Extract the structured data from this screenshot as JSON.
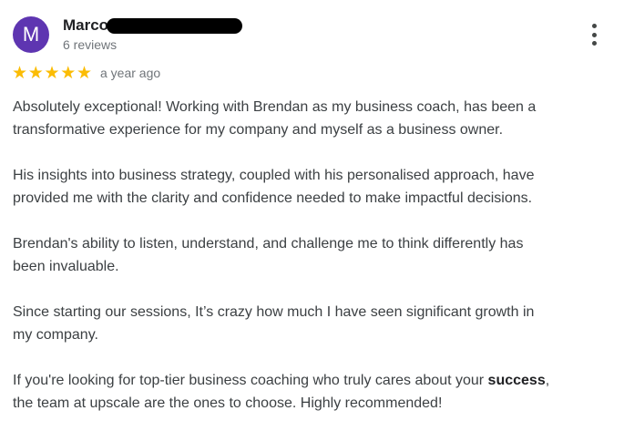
{
  "reviewer": {
    "avatar_initial": "M",
    "avatar_color": "#5e35b1",
    "name": "Marco",
    "name_redacted": true,
    "review_count": "6 reviews"
  },
  "menu": {
    "icon": "more-vert-icon"
  },
  "rating": {
    "stars": 5,
    "max_stars": 5,
    "star_glyph": "★",
    "star_color": "#fbbc04",
    "date": "a year ago"
  },
  "body": {
    "p1": "Absolutely exceptional! Working with Brendan as my business coach, has been a\ntransformative experience for my company and myself as a business owner.",
    "p2": "His insights into business strategy, coupled with his personalised approach, have\nprovided me with the clarity and confidence needed to make impactful decisions.",
    "p3": "Brendan's ability to listen, understand, and challenge me to think differently has\nbeen invaluable.",
    "p4": "Since starting our sessions, It’s crazy how much I have seen significant growth in\nmy company.",
    "p5_before": "If you're looking for top-tier business coaching who truly cares about your ",
    "p5_bold": "success",
    "p5_after": ",\nthe team at upscale are the ones to choose. Highly recommended!"
  }
}
